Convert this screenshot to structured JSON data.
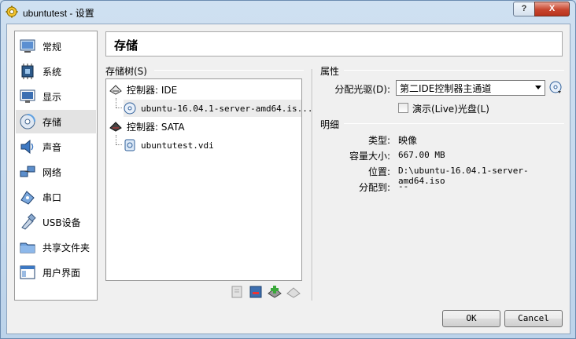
{
  "window": {
    "title": "ubuntutest - 设置",
    "help_label": "?",
    "close_label": "X"
  },
  "sidebar": {
    "items": [
      {
        "label": "常规",
        "icon": "general-icon"
      },
      {
        "label": "系统",
        "icon": "system-icon"
      },
      {
        "label": "显示",
        "icon": "display-icon"
      },
      {
        "label": "存储",
        "icon": "storage-icon",
        "selected": true
      },
      {
        "label": "声音",
        "icon": "audio-icon"
      },
      {
        "label": "网络",
        "icon": "network-icon"
      },
      {
        "label": "串口",
        "icon": "serial-port-icon"
      },
      {
        "label": "USB设备",
        "icon": "usb-icon"
      },
      {
        "label": "共享文件夹",
        "icon": "shared-folder-icon"
      },
      {
        "label": "用户界面",
        "icon": "user-interface-icon"
      }
    ]
  },
  "header": {
    "title": "存储"
  },
  "storage_tree": {
    "label": "存储树(S)",
    "controllers": [
      {
        "label": "控制器: IDE",
        "devices": [
          "ubuntu-16.04.1-server-amd64.is..."
        ]
      },
      {
        "label": "控制器: SATA",
        "devices": [
          "ubuntutest.vdi"
        ]
      }
    ]
  },
  "attributes": {
    "label": "属性",
    "drive_label": "分配光驱(D):",
    "drive_value": "第二IDE控制器主通道",
    "live_cd_label": "演示(Live)光盘(L)",
    "live_cd_checked": false
  },
  "details": {
    "label": "明细",
    "rows": [
      {
        "key": "类型:",
        "value": "映像"
      },
      {
        "key": "容量大小:",
        "value": "667.00  MB"
      },
      {
        "key": "位置:",
        "value": "D:\\ubuntu-16.04.1-server-amd64.iso"
      },
      {
        "key": "分配到:",
        "value": "--"
      }
    ]
  },
  "buttons": {
    "ok": "OK",
    "cancel": "Cancel"
  }
}
